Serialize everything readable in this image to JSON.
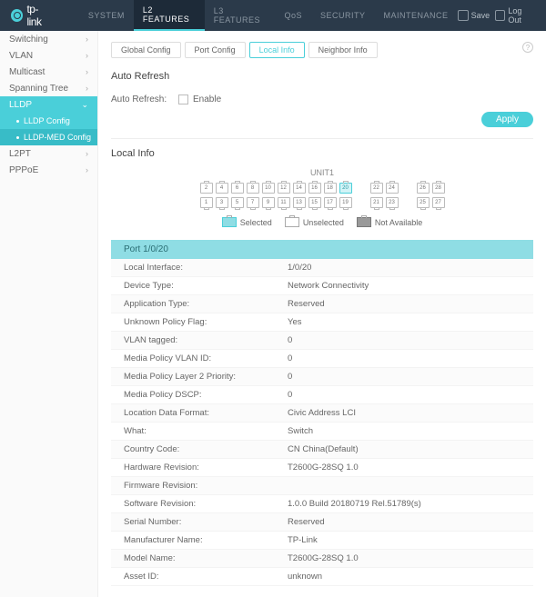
{
  "brand": "tp-link",
  "topnav": [
    "SYSTEM",
    "L2 FEATURES",
    "L3 FEATURES",
    "QoS",
    "SECURITY",
    "MAINTENANCE"
  ],
  "topnav_active": 1,
  "actions": {
    "save": "Save",
    "logout": "Log Out"
  },
  "sidebar": {
    "items": [
      "Switching",
      "VLAN",
      "Multicast",
      "Spanning Tree",
      "LLDP",
      "L2PT",
      "PPPoE"
    ],
    "expanded": "LLDP",
    "subs": [
      "LLDP Config",
      "LLDP-MED Config"
    ],
    "sub_active": 1
  },
  "tabs": [
    "Global Config",
    "Port Config",
    "Local Info",
    "Neighbor Info"
  ],
  "tab_active": 2,
  "section_autorefresh": "Auto Refresh",
  "auto_refresh_label": "Auto Refresh:",
  "enable_label": "Enable",
  "apply_label": "Apply",
  "section_local": "Local Info",
  "unit_label": "UNIT1",
  "ports_top": [
    "2",
    "4",
    "6",
    "8",
    "10",
    "12",
    "14",
    "16",
    "18",
    "20",
    "",
    "22",
    "24",
    "",
    "26",
    "28"
  ],
  "ports_bottom": [
    "1",
    "3",
    "5",
    "7",
    "9",
    "11",
    "13",
    "15",
    "17",
    "19",
    "",
    "21",
    "23",
    "",
    "25",
    "27"
  ],
  "port_selected": "20",
  "legend": {
    "selected": "Selected",
    "unselected": "Unselected",
    "na": "Not Available"
  },
  "info_head": "Port 1/0/20",
  "info": [
    {
      "k": "Local Interface:",
      "v": "1/0/20"
    },
    {
      "k": "Device Type:",
      "v": "Network Connectivity"
    },
    {
      "k": "Application Type:",
      "v": "Reserved"
    },
    {
      "k": "Unknown Policy Flag:",
      "v": "Yes"
    },
    {
      "k": "VLAN tagged:",
      "v": "0"
    },
    {
      "k": "Media Policy VLAN ID:",
      "v": "0"
    },
    {
      "k": "Media Policy Layer 2 Priority:",
      "v": "0"
    },
    {
      "k": "Media Policy DSCP:",
      "v": "0"
    },
    {
      "k": "Location Data Format:",
      "v": "Civic Address LCI"
    },
    {
      "k": "What:",
      "v": "Switch"
    },
    {
      "k": "Country Code:",
      "v": "CN China(Default)"
    },
    {
      "k": "Hardware Revision:",
      "v": "T2600G-28SQ 1.0"
    },
    {
      "k": "Firmware Revision:",
      "v": ""
    },
    {
      "k": "Software Revision:",
      "v": "1.0.0 Build 20180719 Rel.51789(s)"
    },
    {
      "k": "Serial Number:",
      "v": "Reserved"
    },
    {
      "k": "Manufacturer Name:",
      "v": "TP-Link"
    },
    {
      "k": "Model Name:",
      "v": "T2600G-28SQ 1.0"
    },
    {
      "k": "Asset ID:",
      "v": "unknown"
    }
  ]
}
